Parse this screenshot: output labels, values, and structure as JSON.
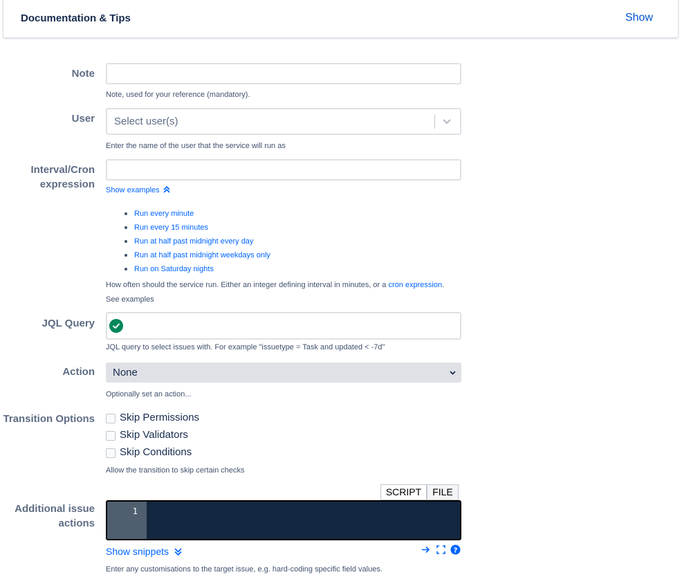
{
  "doc_panel": {
    "title": "Documentation & Tips",
    "toggle": "Show"
  },
  "note": {
    "label": "Note",
    "value": "",
    "help": "Note, used for your reference (mandatory)."
  },
  "user": {
    "label": "User",
    "placeholder": "Select user(s)",
    "help": "Enter the name of the user that the service will run as"
  },
  "interval": {
    "label_line1": "Interval/Cron",
    "label_line2": "expression",
    "value": "",
    "show_examples": "Show examples",
    "examples": [
      "Run every minute",
      "Run every 15 minutes",
      "Run at half past midnight every day",
      "Run at half past midnight weekdays only",
      "Run on Saturday nights"
    ],
    "help_prefix": "How often should the service run. Either an integer defining interval in minutes, or a",
    "help_link": "cron expression",
    "help_suffix": ".",
    "help_line2": "See examples"
  },
  "jql": {
    "label": "JQL Query",
    "value": "",
    "help": "JQL query to select issues with. For example \"issuetype = Task and updated < -7d\""
  },
  "action": {
    "label": "Action",
    "selected": "None",
    "help": "Optionally set an action..."
  },
  "transition": {
    "label": "Transition Options",
    "options": [
      {
        "label": "Skip Permissions",
        "checked": false
      },
      {
        "label": "Skip Validators",
        "checked": false
      },
      {
        "label": "Skip Conditions",
        "checked": false
      }
    ],
    "help": "Allow the transition to skip certain checks"
  },
  "additional": {
    "label_line1": "Additional issue",
    "label_line2": "actions",
    "tabs": [
      "SCRIPT",
      "FILE"
    ],
    "line_number": "1",
    "show_snippets": "Show snippets",
    "help": "Enter any customisations to the target issue, e.g. hard-coding specific field values."
  },
  "colors": {
    "link": "#0065ff",
    "success": "#00875a",
    "editor_bg": "#12263f"
  }
}
